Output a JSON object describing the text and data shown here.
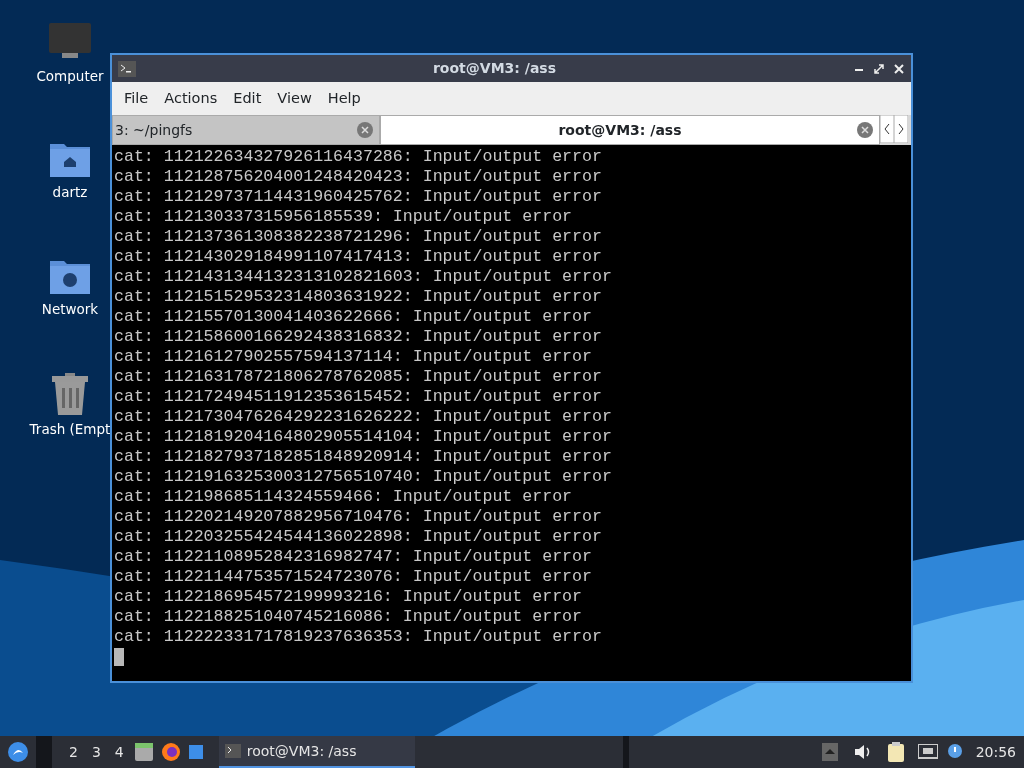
{
  "desktop_icons": [
    {
      "label": "Computer",
      "kind": "computer"
    },
    {
      "label": "dartz",
      "kind": "home"
    },
    {
      "label": "Network",
      "kind": "network"
    },
    {
      "label": "Trash (Empt",
      "kind": "trash"
    }
  ],
  "window": {
    "title": "root@VM3: /ass",
    "menu": [
      "File",
      "Actions",
      "Edit",
      "View",
      "Help"
    ],
    "tabs": [
      {
        "label": "3: ~/pingfs",
        "selected": false
      },
      {
        "label": "root@VM3: /ass",
        "selected": true
      }
    ],
    "lines": [
      "cat: 112122634327926116437286: Input/output error",
      "cat: 112128756204001248420423: Input/output error",
      "cat: 112129737114431960425762: Input/output error",
      "cat: 112130337315956185539: Input/output error",
      "cat: 112137361308382238721296: Input/output error",
      "cat: 112143029184991107417413: Input/output error",
      "cat: 1121431344132313102821603: Input/output error",
      "cat: 112151529532314803631922: Input/output error",
      "cat: 11215570130041403622666: Input/output error",
      "cat: 112158600166292438316832: Input/output error",
      "cat: 11216127902557594137114: Input/output error",
      "cat: 112163178721806278762085: Input/output error",
      "cat: 112172494511912353615452: Input/output error",
      "cat: 1121730476264292231626222: Input/output error",
      "cat: 1121819204164802905514104: Input/output error",
      "cat: 1121827937182851848920914: Input/output error",
      "cat: 1121916325300312756510740: Input/output error",
      "cat: 112198685114324559466: Input/output error",
      "cat: 112202149207882956710476: Input/output error",
      "cat: 112203255424544136022898: Input/output error",
      "cat: 11221108952842316982747: Input/output error",
      "cat: 11221144753571524723076: Input/output error",
      "cat: 1122186954572199993216: Input/output error",
      "cat: 1122188251040745216086: Input/output error",
      "cat: 112222331717819237636353: Input/output error"
    ]
  },
  "taskbar": {
    "workspaces": [
      {
        "label": "2"
      },
      {
        "label": "3"
      },
      {
        "label": "4"
      }
    ],
    "tasks": [
      {
        "label": "root@VM3: /ass",
        "selected": true
      }
    ],
    "clock": "20:56"
  }
}
